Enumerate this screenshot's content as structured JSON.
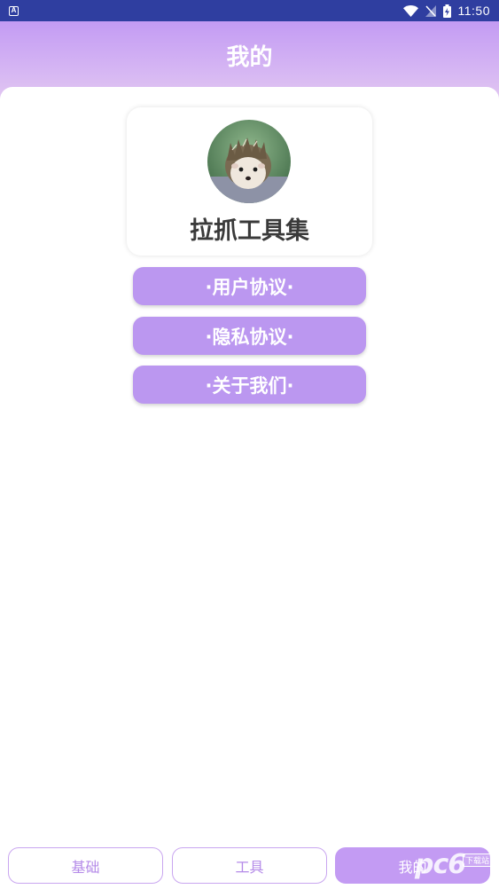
{
  "status_bar": {
    "time": "11:50",
    "left_icon": "A",
    "icons": [
      "wifi-icon",
      "no-signal-icon",
      "battery-charging-icon"
    ]
  },
  "header": {
    "title": "我的"
  },
  "profile": {
    "app_name": "拉抓工具集",
    "avatar": "hedgehog-avatar"
  },
  "menu": [
    {
      "label": "·用户协议·"
    },
    {
      "label": "·隐私协议·"
    },
    {
      "label": "·关于我们·"
    }
  ],
  "tabs": [
    {
      "label": "基础",
      "active": false
    },
    {
      "label": "工具",
      "active": false
    },
    {
      "label": "我的",
      "active": true
    }
  ],
  "watermark": {
    "text": "pc6",
    "sub": "下载站"
  },
  "colors": {
    "accent": "#bb97f0",
    "header_start": "#c39bf3",
    "header_end": "#e6cdf0",
    "status_bar": "#2f3ea0"
  }
}
